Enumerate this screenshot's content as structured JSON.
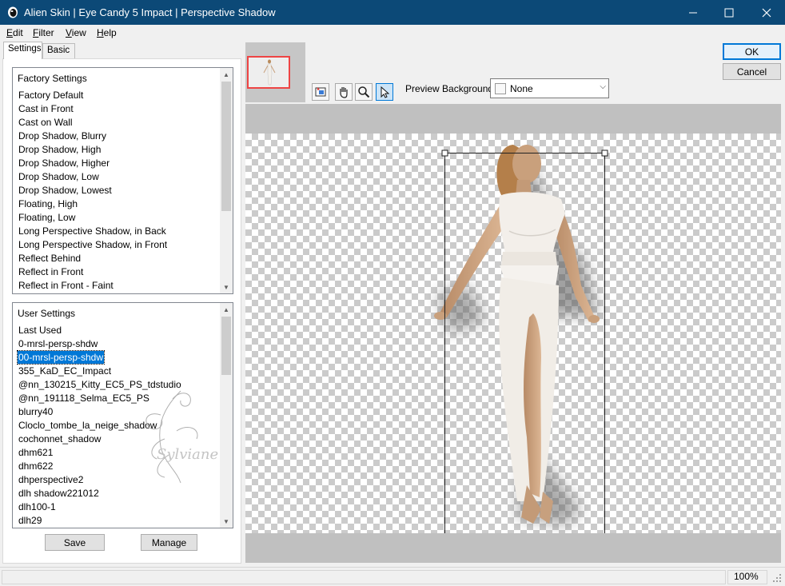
{
  "window": {
    "title": "Alien Skin | Eye Candy 5 Impact | Perspective Shadow",
    "minimize_glyph": "—",
    "maximize_glyph": "☐",
    "close_glyph": "✕",
    "titlebar_color": "#0c4977"
  },
  "menu": [
    {
      "label": "Edit",
      "mnemonic": "E"
    },
    {
      "label": "Filter",
      "mnemonic": "F"
    },
    {
      "label": "View",
      "mnemonic": "V"
    },
    {
      "label": "Help",
      "mnemonic": "H"
    }
  ],
  "tabs": {
    "settings": "Settings",
    "basic": "Basic"
  },
  "factory_settings": {
    "header": "Factory Settings",
    "items": [
      "Factory Default",
      "Cast in Front",
      "Cast on Wall",
      "Drop Shadow, Blurry",
      "Drop Shadow, High",
      "Drop Shadow, Higher",
      "Drop Shadow, Low",
      "Drop Shadow, Lowest",
      "Floating, High",
      "Floating, Low",
      "Long Perspective Shadow, in Back",
      "Long Perspective Shadow, in Front",
      "Reflect Behind",
      "Reflect in Front",
      "Reflect in Front - Faint"
    ]
  },
  "user_settings": {
    "header": "User Settings",
    "selected": "00-mrsl-persp-shdw",
    "items": [
      "Last Used",
      "0-mrsl-persp-shdw",
      "00-mrsl-persp-shdw",
      "355_KaD_EC_Impact",
      "@nn_130215_Kitty_EC5_PS_tdstudio",
      "@nn_191118_Selma_EC5_PS",
      "blurry40",
      "Cloclo_tombe_la_neige_shadow",
      "cochonnet_shadow",
      "dhm621",
      "dhm622",
      "dhperspective2",
      "dlh shadow221012",
      "dlh100-1",
      "dlh29"
    ]
  },
  "watermark": "Sylviane",
  "buttons": {
    "save": "Save",
    "manage": "Manage",
    "ok": "OK",
    "cancel": "Cancel"
  },
  "preview": {
    "background_label": "Preview Background:",
    "background_value": "None",
    "tools": [
      "preview-navigate-icon",
      "hand-icon",
      "zoom-icon",
      "select-arrow-icon"
    ],
    "active_tool": "select-arrow-icon"
  },
  "status": {
    "zoom": "100%"
  },
  "colors": {
    "selection": "#0078d7",
    "ok_border": "#0078d7"
  }
}
